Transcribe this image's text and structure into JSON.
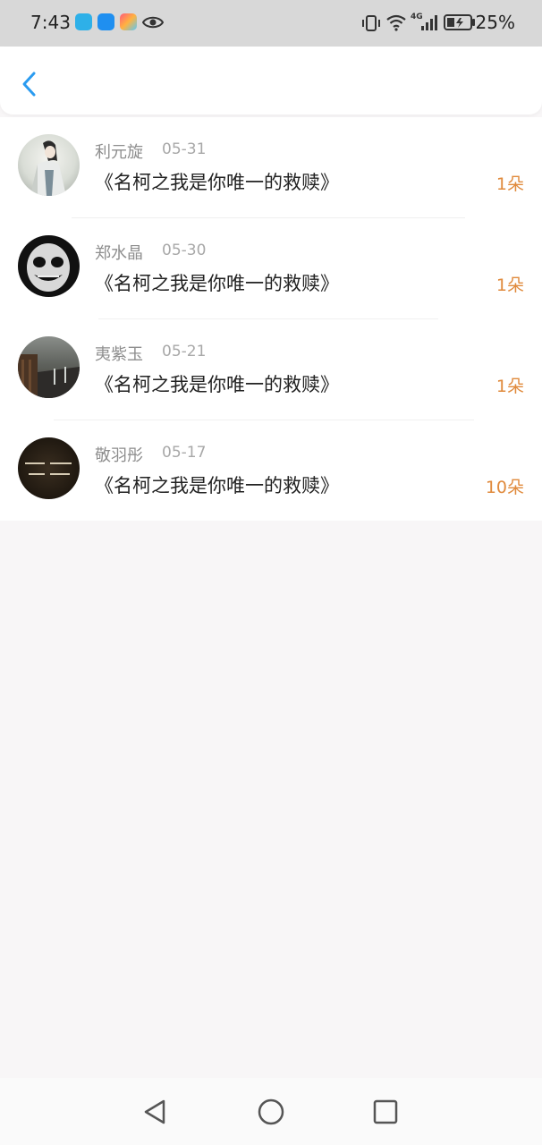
{
  "status_bar": {
    "time": "7:43",
    "battery": "25%",
    "network": "4G",
    "icons": [
      "app-icon-blue",
      "app-icon-weather",
      "app-icon-colorful",
      "eye-icon",
      "vibrate-icon",
      "wifi-icon",
      "signal-icon",
      "battery-icon"
    ]
  },
  "header": {
    "back_icon": "chevron-left-icon"
  },
  "records": [
    {
      "name": "利元旋",
      "date": "05-31",
      "title": "《名柯之我是你唯一的救赎》",
      "amount": "1朵"
    },
    {
      "name": "郑水晶",
      "date": "05-30",
      "title": "《名柯之我是你唯一的救赎》",
      "amount": "1朵"
    },
    {
      "name": "夷紫玉",
      "date": "05-21",
      "title": "《名柯之我是你唯一的救赎》",
      "amount": "1朵"
    },
    {
      "name": "敬羽彤",
      "date": "05-17",
      "title": "《名柯之我是你唯一的救赎》",
      "amount": "10朵"
    }
  ],
  "colors": {
    "accent": "#2a9bf0",
    "amount": "#e08a3c",
    "name": "#8e8e8e",
    "date": "#a8a8a8"
  },
  "nav_bar": {
    "icons": [
      "back-triangle-icon",
      "home-circle-icon",
      "recents-square-icon"
    ]
  }
}
